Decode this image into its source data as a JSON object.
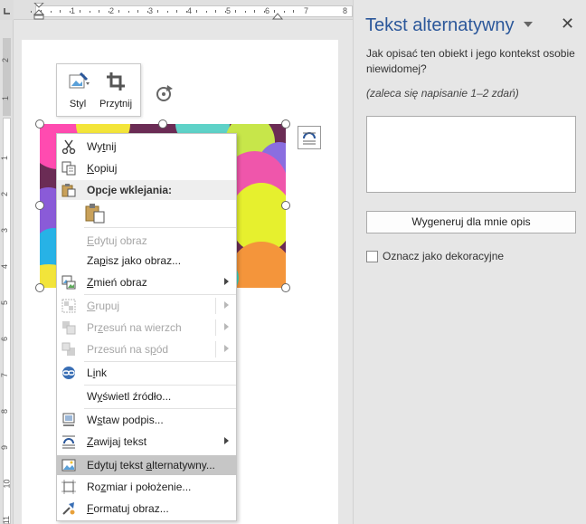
{
  "ruler": {
    "h_ticks": [
      "1",
      "2",
      "3",
      "4",
      "5",
      "6",
      "7",
      "8"
    ],
    "v_ticks": [
      "1",
      "2",
      "3",
      "4",
      "5",
      "6",
      "7",
      "8",
      "9",
      "10",
      "11"
    ],
    "v_top": "2",
    "v_sub": "1"
  },
  "mini_toolbar": {
    "style_label": "Styl",
    "crop_label": "Przytnij"
  },
  "context_menu": {
    "items": [
      {
        "label": "Wytnij",
        "icon": "scissors-icon",
        "enabled": true
      },
      {
        "label": "Kopiuj",
        "icon": "copy-icon",
        "enabled": true
      },
      {
        "label": "Opcje wklejania:",
        "icon": "paste-icon",
        "enabled": true
      },
      {
        "label": "Edytuj obraz",
        "enabled": false
      },
      {
        "label": "Zapisz jako obraz...",
        "enabled": true
      },
      {
        "label": "Zmień obraz",
        "icon": "change-picture-icon",
        "enabled": true,
        "submenu": true
      },
      {
        "label": "Grupuj",
        "icon": "group-icon",
        "enabled": false,
        "submenu": true
      },
      {
        "label": "Przesuń na wierzch",
        "icon": "bring-forward-icon",
        "enabled": false,
        "submenu": true
      },
      {
        "label": "Przesuń na spód",
        "icon": "send-backward-icon",
        "enabled": false,
        "submenu": true
      },
      {
        "label": "Link",
        "icon": "link-icon",
        "enabled": true
      },
      {
        "label": "Wyświetl źródło...",
        "enabled": true
      },
      {
        "label": "Wstaw podpis...",
        "icon": "caption-icon",
        "enabled": true
      },
      {
        "label": "Zawijaj tekst",
        "icon": "wrap-text-icon",
        "enabled": true,
        "submenu": true
      },
      {
        "label": "Edytuj tekst alternatywny...",
        "icon": "alt-text-icon",
        "enabled": true,
        "highlighted": true
      },
      {
        "label": "Rozmiar i położenie...",
        "icon": "size-position-icon",
        "enabled": true
      },
      {
        "label": "Formatuj obraz...",
        "icon": "format-picture-icon",
        "enabled": true
      }
    ]
  },
  "pane": {
    "title": "Tekst alternatywny",
    "question": "Jak opisać ten obiekt i jego kontekst osobie niewidomej?",
    "hint": "(zaleca się napisanie 1–2 zdań)",
    "text_value": "",
    "generate_button": "Wygeneruj dla mnie opis",
    "decorative_label": "Oznacz jako dekoracyjne",
    "decorative_checked": false
  },
  "colors": {
    "accent": "#2b579a",
    "menu_highlight": "#c6c6c6"
  }
}
